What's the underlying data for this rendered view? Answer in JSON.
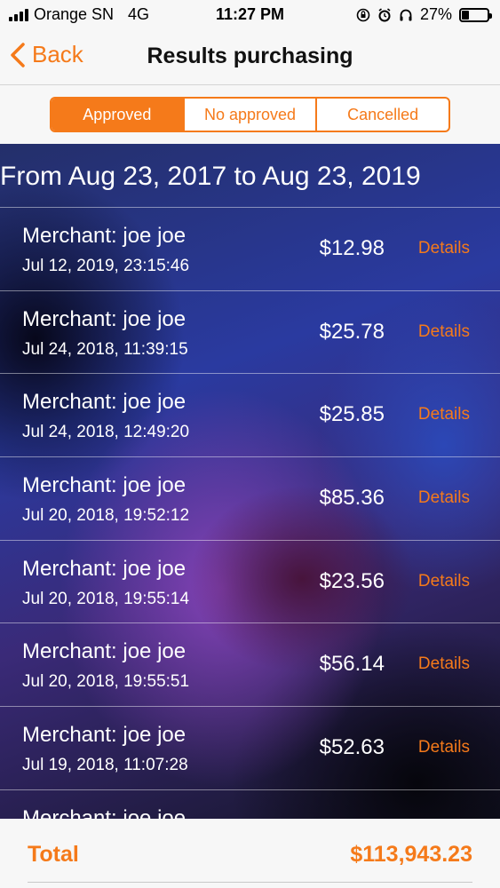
{
  "status_bar": {
    "carrier": "Orange SN",
    "network": "4G",
    "time": "11:27 PM",
    "battery_percent": "27%",
    "battery_level": 0.27
  },
  "nav": {
    "back_label": "Back",
    "title": "Results purchasing"
  },
  "segments": [
    {
      "label": "Approved",
      "active": true
    },
    {
      "label": "No approved",
      "active": false
    },
    {
      "label": "Cancelled",
      "active": false
    }
  ],
  "range_title": "From Aug 23, 2017 to Aug 23, 2019",
  "transactions": [
    {
      "merchant": "Merchant: joe joe",
      "date": "Jul 12, 2019, 23:15:46",
      "amount": "$12.98",
      "details": "Details"
    },
    {
      "merchant": "Merchant: joe joe",
      "date": "Jul 24, 2018, 11:39:15",
      "amount": "$25.78",
      "details": "Details"
    },
    {
      "merchant": "Merchant: joe joe",
      "date": "Jul 24, 2018, 12:49:20",
      "amount": "$25.85",
      "details": "Details"
    },
    {
      "merchant": "Merchant: joe joe",
      "date": "Jul 20, 2018, 19:52:12",
      "amount": "$85.36",
      "details": "Details"
    },
    {
      "merchant": "Merchant: joe joe",
      "date": "Jul 20, 2018, 19:55:14",
      "amount": "$23.56",
      "details": "Details"
    },
    {
      "merchant": "Merchant: joe joe",
      "date": "Jul 20, 2018, 19:55:51",
      "amount": "$56.14",
      "details": "Details"
    },
    {
      "merchant": "Merchant: joe joe",
      "date": "Jul 19, 2018, 11:07:28",
      "amount": "$52.63",
      "details": "Details"
    },
    {
      "merchant": "Merchant: joe joe",
      "date": "",
      "amount": "",
      "details": ""
    }
  ],
  "footer": {
    "total_label": "Total",
    "total_value": "$113,943.23"
  },
  "colors": {
    "accent": "#f57a1a"
  },
  "icons": {
    "back": "chevron-left-icon",
    "signal": "signal-icon",
    "lock": "orientation-lock-icon",
    "alarm": "alarm-icon",
    "headphones": "headphones-icon",
    "battery": "battery-icon"
  }
}
